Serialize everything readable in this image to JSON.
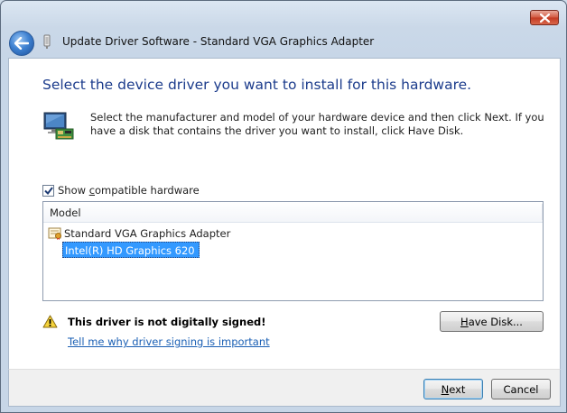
{
  "window": {
    "title": "Update Driver Software - Standard VGA Graphics Adapter"
  },
  "page": {
    "heading": "Select the device driver you want to install for this hardware.",
    "description": "Select the manufacturer and model of your hardware device and then click Next. If you have a disk that contains the driver you want to install, click Have Disk."
  },
  "compat_checkbox": {
    "label_prefix": "Show ",
    "label_access_key": "c",
    "label_suffix": "ompatible hardware",
    "checked": true
  },
  "model_list": {
    "column_header": "Model",
    "manufacturer": "Standard VGA Graphics Adapter",
    "selected_model": "Intel(R) HD Graphics 620"
  },
  "warning": {
    "text": "This driver is not digitally signed!",
    "link": "Tell me why driver signing is important"
  },
  "buttons": {
    "have_disk_access_key": "H",
    "have_disk_rest": "ave Disk...",
    "next_access_key": "N",
    "next_rest": "ext",
    "cancel": "Cancel"
  },
  "icons": {
    "back": "back-arrow-icon",
    "close": "close-icon",
    "device": "monitor-device-icon",
    "warning": "warning-triangle-icon",
    "manufacturer": "driver-certificate-icon",
    "title": "device-plug-icon"
  },
  "colors": {
    "heading": "#1c3c8c",
    "link": "#1a5fb4",
    "selection": "#3399ff",
    "close_button": "#c33a22"
  }
}
